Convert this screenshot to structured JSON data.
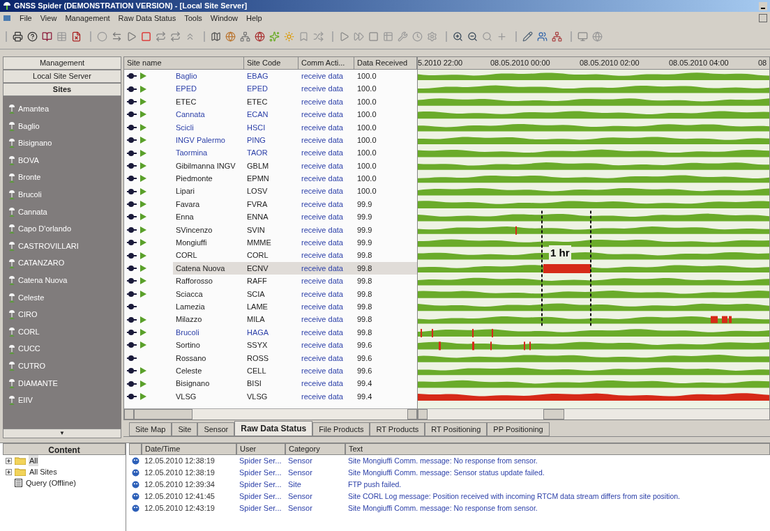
{
  "window": {
    "title": "GNSS Spider  (DEMONSTRATION VERSION) - [Local Site Server]"
  },
  "menu": [
    "File",
    "View",
    "Management",
    "Raw Data Status",
    "Tools",
    "Window",
    "Help"
  ],
  "navigator": {
    "sections": [
      {
        "label": "Management",
        "selected": false
      },
      {
        "label": "Local Site Server",
        "selected": false
      },
      {
        "label": "Sites",
        "selected": true
      }
    ],
    "sites": [
      "Amantea",
      "Baglio",
      "Bisignano",
      "BOVA",
      "Bronte",
      "Brucoli",
      "Cannata",
      "Capo D'orlando",
      "CASTROVILLARI",
      "CATANZARO",
      "Catena Nuova",
      "Celeste",
      "CIRO",
      "CORL",
      "CUCC",
      "CUTRO",
      "DIAMANTE",
      "EIIV"
    ],
    "more": "▼"
  },
  "sites_table": {
    "columns": [
      "Site name",
      "Site Code",
      "Comm Acti...",
      "Data Received"
    ],
    "rows": [
      {
        "name": "Baglio",
        "code": "EBAG",
        "activity": "receive data",
        "received": "100.0",
        "color": "#2b3fa8",
        "receiving": true,
        "selected": false
      },
      {
        "name": "EPED",
        "code": "EPED",
        "activity": "receive data",
        "received": "100.0",
        "color": "#2b3fa8",
        "receiving": true,
        "selected": false
      },
      {
        "name": "ETEC",
        "code": "ETEC",
        "activity": "receive data",
        "received": "100.0",
        "color": "#222222",
        "receiving": true,
        "selected": false
      },
      {
        "name": "Cannata",
        "code": "ECAN",
        "activity": "receive data",
        "received": "100.0",
        "color": "#2b3fa8",
        "receiving": true,
        "selected": false
      },
      {
        "name": "Scicli",
        "code": "HSCI",
        "activity": "receive data",
        "received": "100.0",
        "color": "#2b3fa8",
        "receiving": true,
        "selected": false
      },
      {
        "name": "INGV Palermo",
        "code": "PING",
        "activity": "receive data",
        "received": "100.0",
        "color": "#2b3fa8",
        "receiving": true,
        "selected": false
      },
      {
        "name": "Taormina",
        "code": "TAOR",
        "activity": "receive data",
        "received": "100.0",
        "color": "#2b3fa8",
        "receiving": true,
        "selected": false
      },
      {
        "name": "Gibilmanna INGV",
        "code": "GBLM",
        "activity": "receive data",
        "received": "100.0",
        "color": "#222222",
        "receiving": true,
        "selected": false
      },
      {
        "name": "Piedmonte",
        "code": "EPMN",
        "activity": "receive data",
        "received": "100.0",
        "color": "#222222",
        "receiving": true,
        "selected": false
      },
      {
        "name": "Lipari",
        "code": "LOSV",
        "activity": "receive data",
        "received": "100.0",
        "color": "#222222",
        "receiving": true,
        "selected": false
      },
      {
        "name": "Favara",
        "code": "FVRA",
        "activity": "receive data",
        "received": "99.9",
        "color": "#222222",
        "receiving": true,
        "selected": false
      },
      {
        "name": "Enna",
        "code": "ENNA",
        "activity": "receive data",
        "received": "99.9",
        "color": "#222222",
        "receiving": true,
        "selected": false
      },
      {
        "name": "SVincenzo",
        "code": "SVIN",
        "activity": "receive data",
        "received": "99.9",
        "color": "#222222",
        "receiving": true,
        "selected": false
      },
      {
        "name": "Mongiuffi",
        "code": "MMME",
        "activity": "receive data",
        "received": "99.9",
        "color": "#222222",
        "receiving": true,
        "selected": false
      },
      {
        "name": "CORL",
        "code": "CORL",
        "activity": "receive data",
        "received": "99.8",
        "color": "#222222",
        "receiving": true,
        "selected": false
      },
      {
        "name": "Catena Nuova",
        "code": "ECNV",
        "activity": "receive data",
        "received": "99.8",
        "color": "#222222",
        "receiving": true,
        "selected": true
      },
      {
        "name": "Rafforosso",
        "code": "RAFF",
        "activity": "receive data",
        "received": "99.8",
        "color": "#222222",
        "receiving": true,
        "selected": false
      },
      {
        "name": "Sciacca",
        "code": "SCIA",
        "activity": "receive data",
        "received": "99.8",
        "color": "#222222",
        "receiving": true,
        "selected": false
      },
      {
        "name": "Lamezia",
        "code": "LAME",
        "activity": "receive data",
        "received": "99.8",
        "color": "#222222",
        "receiving": false,
        "selected": false
      },
      {
        "name": "Milazzo",
        "code": "MILA",
        "activity": "receive data",
        "received": "99.8",
        "color": "#222222",
        "receiving": true,
        "selected": false
      },
      {
        "name": "Brucoli",
        "code": "HAGA",
        "activity": "receive data",
        "received": "99.8",
        "color": "#2b3fa8",
        "receiving": true,
        "selected": false
      },
      {
        "name": "Sortino",
        "code": "SSYX",
        "activity": "receive data",
        "received": "99.6",
        "color": "#222222",
        "receiving": true,
        "selected": false
      },
      {
        "name": "Rossano",
        "code": "ROSS",
        "activity": "receive data",
        "received": "99.6",
        "color": "#222222",
        "receiving": false,
        "selected": false
      },
      {
        "name": "Celeste",
        "code": "CELL",
        "activity": "receive data",
        "received": "99.6",
        "color": "#222222",
        "receiving": true,
        "selected": false
      },
      {
        "name": "Bisignano",
        "code": "BISI",
        "activity": "receive data",
        "received": "99.4",
        "color": "#222222",
        "receiving": true,
        "selected": false
      },
      {
        "name": "VLSG",
        "code": "VLSG",
        "activity": "receive data",
        "received": "99.4",
        "color": "#222222",
        "receiving": true,
        "selected": false
      }
    ]
  },
  "timeline": {
    "labels": [
      "5.2010 22:00",
      "08.05.2010 00:00",
      "08.05.2010 02:00",
      "08.05.2010 04:00",
      "08"
    ],
    "annotation": "1 hr"
  },
  "tabs": [
    {
      "label": "Site Map",
      "selected": false
    },
    {
      "label": "Site",
      "selected": false
    },
    {
      "label": "Sensor",
      "selected": false
    },
    {
      "label": "Raw Data Status",
      "selected": true
    },
    {
      "label": "File Products",
      "selected": false
    },
    {
      "label": "RT Products",
      "selected": false
    },
    {
      "label": "RT Positioning",
      "selected": false
    },
    {
      "label": "PP Positioning",
      "selected": false
    }
  ],
  "content": {
    "title": "Content",
    "items": [
      {
        "label": "All",
        "kind": "folder",
        "selected": true
      },
      {
        "label": "All Sites",
        "kind": "folder",
        "selected": false
      },
      {
        "label": "Query (Offline)",
        "kind": "query",
        "selected": false
      }
    ]
  },
  "log": {
    "columns": [
      "Date/Time",
      "User",
      "Category",
      "Text"
    ],
    "rows": [
      {
        "time": "12.05.2010 12:38:19",
        "user": "Spider Ser...",
        "category": "Sensor",
        "text": "Site Mongiuffi Comm. message: No response from sensor."
      },
      {
        "time": "12.05.2010 12:38:19",
        "user": "Spider Ser...",
        "category": "Sensor",
        "text": "Site Mongiuffi Comm. message: Sensor status update failed."
      },
      {
        "time": "12.05.2010 12:39:34",
        "user": "Spider Ser...",
        "category": "Site",
        "text": "FTP push failed."
      },
      {
        "time": "12.05.2010 12:41:45",
        "user": "Spider Ser...",
        "category": "Sensor",
        "text": "Site CORL Log message: Position received with incoming RTCM data stream differs from site position."
      },
      {
        "time": "12.05.2010 12:43:19",
        "user": "Spider Ser...",
        "category": "Sensor",
        "text": "Site Mongiuffi Comm. message: No response from sensor."
      }
    ]
  }
}
